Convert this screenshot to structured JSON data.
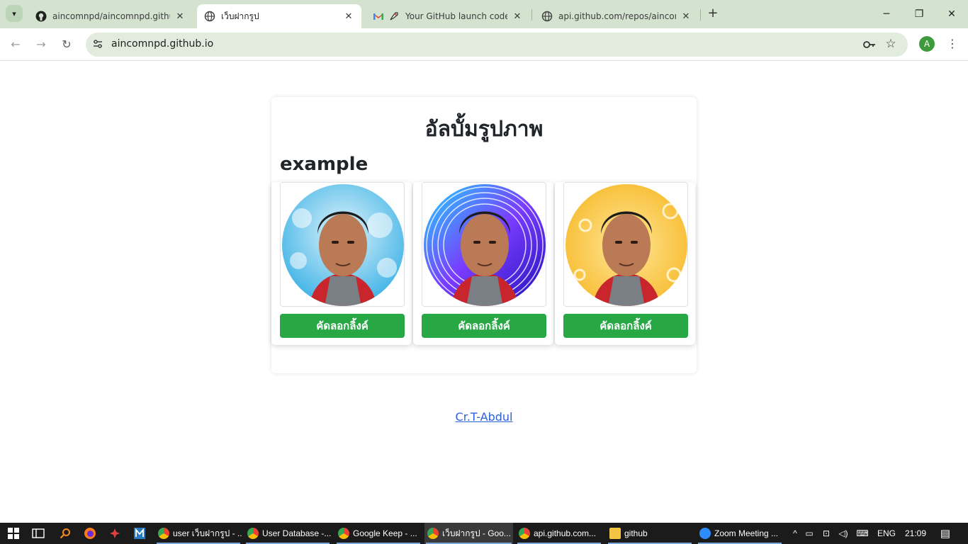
{
  "browser": {
    "tabs": [
      {
        "title": "aincomnpd/aincomnpd.github.io",
        "icon": "github-icon",
        "active": false
      },
      {
        "title": "เว็บฝากรูป",
        "icon": "globe-icon",
        "active": true
      },
      {
        "title": "Your GitHub launch code - aincomnpd@gmail.com",
        "icon": "gmail-icon",
        "active": false
      },
      {
        "title": "api.github.com/repos/aincomnpd",
        "icon": "globe-icon",
        "active": false
      }
    ],
    "url": "aincomnpd.github.io",
    "profile_initial": "A"
  },
  "page": {
    "title": "อัลบั้มรูปภาพ",
    "section_title": "example",
    "cards": [
      {
        "button_label": "คัดลอกลิ้งค์",
        "frame_style": "blue-world-map"
      },
      {
        "button_label": "คัดลอกลิ้งค์",
        "frame_style": "purple-rings"
      },
      {
        "button_label": "คัดลอกลิ้งค์",
        "frame_style": "yellow-confetti"
      }
    ],
    "footer_link": "Cr.T-Abdul"
  },
  "taskbar": {
    "apps": [
      {
        "label": "user เว็บฝากรูป - ...",
        "icon": "chrome-icon"
      },
      {
        "label": "User Database -...",
        "icon": "chrome-icon"
      },
      {
        "label": "Google Keep - ...",
        "icon": "chrome-icon"
      },
      {
        "label": "เว็บฝากรูป - Goo...",
        "icon": "chrome-icon",
        "active": true
      },
      {
        "label": "api.github.com...",
        "icon": "chrome-icon"
      },
      {
        "label": "github",
        "icon": "folder-icon"
      },
      {
        "label": "Zoom Meeting ...",
        "icon": "zoom-icon"
      }
    ],
    "language": "ENG",
    "time": "21:09"
  },
  "colors": {
    "tabstrip": "#d3e3d0",
    "button": "#28a745",
    "link": "#2a62d6"
  }
}
